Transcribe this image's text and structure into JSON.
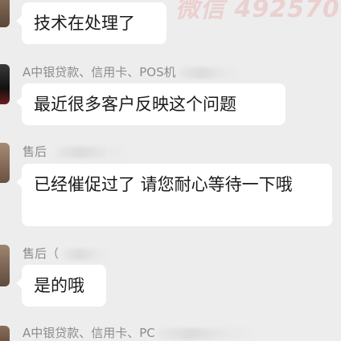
{
  "watermark": "微信 492570",
  "messages": [
    {
      "sender": "",
      "text": "技术在处理了"
    },
    {
      "sender": "A中银贷款、信用卡、POS机",
      "text": "最近很多客户反映这个问题"
    },
    {
      "sender": "售后",
      "text": "已经催促过了  请您耐心等待一下哦"
    },
    {
      "sender": "售后（",
      "text": "是的哦"
    },
    {
      "sender": "A中银贷款、信用卡、PC",
      "text": ""
    }
  ],
  "colors": {
    "background": "#ededed",
    "bubble": "#ffffff",
    "sender_text": "#8c8c8c",
    "message_text": "#1a1a1a"
  }
}
